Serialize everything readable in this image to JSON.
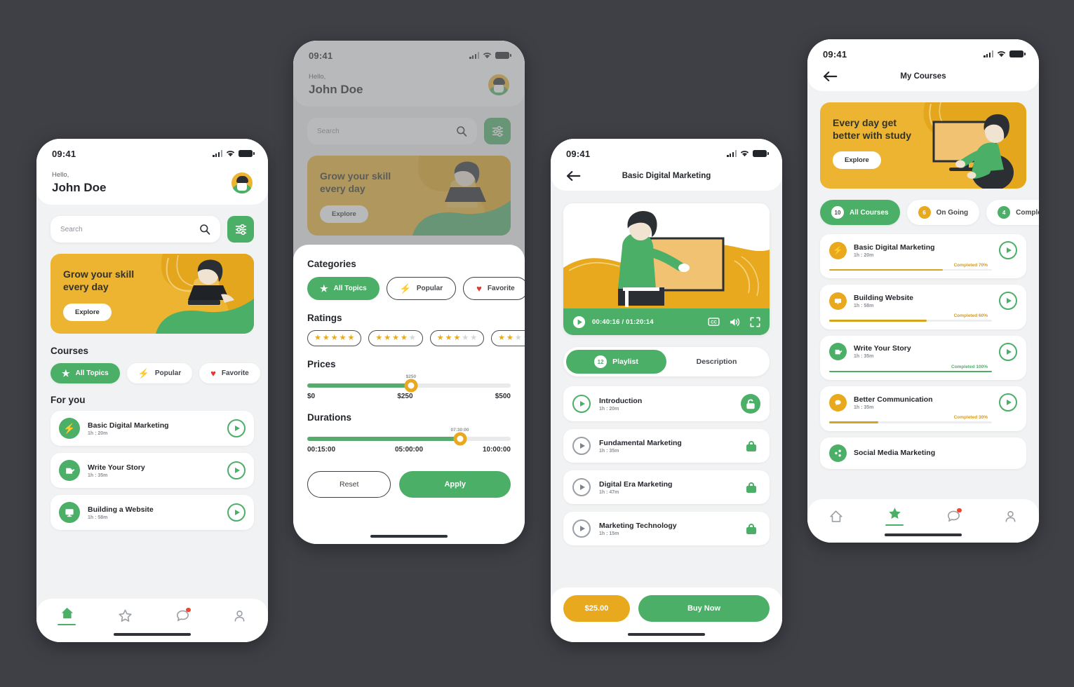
{
  "canvas": {
    "background": "#3e4046"
  },
  "theme": {
    "green": "#4caf68",
    "yellow": "#e8a91e",
    "banner_bg": "#edb431",
    "dark": "#23262b"
  },
  "status_bar": {
    "time": "09:41"
  },
  "screen_home": {
    "greeting_small": "Hello,",
    "user_name": "John Doe",
    "search": {
      "placeholder": "Search",
      "icon": "search-icon"
    },
    "filter_button_icon": "sliders-icon",
    "banner": {
      "title": "Grow your skill\never y day",
      "title_line1": "Grow your skill",
      "title_line2": "every day",
      "cta": "Explore"
    },
    "courses_heading": "Courses",
    "category_chips": [
      {
        "label": "All Topics",
        "icon": "star-icon",
        "active": true
      },
      {
        "label": "Popular",
        "icon": "bolt-icon",
        "active": false
      },
      {
        "label": "Favorite",
        "icon": "heart-icon",
        "active": false
      }
    ],
    "for_you_heading": "For you",
    "courses": [
      {
        "title": "Basic Digital Marketing",
        "duration": "1h : 20m",
        "icon": "bolt-icon"
      },
      {
        "title": "Write Your Story",
        "duration": "1h : 35m",
        "icon": "hand-write-icon"
      },
      {
        "title": "Building a Website",
        "duration": "1h : 58m",
        "icon": "monitor-icon"
      }
    ],
    "nav": [
      {
        "name": "home",
        "icon": "home-icon",
        "active": true,
        "badge": false
      },
      {
        "name": "favorites",
        "icon": "star-icon",
        "active": false,
        "badge": false
      },
      {
        "name": "messages",
        "icon": "chat-icon",
        "active": false,
        "badge": true
      },
      {
        "name": "profile",
        "icon": "user-icon",
        "active": false,
        "badge": false
      }
    ]
  },
  "screen_filter": {
    "greeting_small": "Hello,",
    "user_name": "John Doe",
    "search": {
      "placeholder": "Search"
    },
    "banner": {
      "title_line1": "Grow your skill",
      "title_line2": "every day",
      "cta": "Explore"
    },
    "sheet": {
      "categories_heading": "Categories",
      "category_chips": [
        {
          "label": "All Topics",
          "icon": "star-icon",
          "active": true
        },
        {
          "label": "Popular",
          "icon": "bolt-icon",
          "active": false
        },
        {
          "label": "Favorite",
          "icon": "heart-icon",
          "active": false
        }
      ],
      "ratings_heading": "Ratings",
      "rating_options": [
        5,
        4,
        3,
        2
      ],
      "prices_heading": "Prices",
      "price_knob_label": "$250",
      "price_scale": [
        "$0",
        "$250",
        "$500"
      ],
      "price_fill_percent": 58,
      "durations_heading": "Durations",
      "duration_knob_label": "07:30:00",
      "duration_scale": [
        "00:15:00",
        "05:00:00",
        "10:00:00"
      ],
      "duration_fill_percent": 74,
      "reset_label": "Reset",
      "apply_label": "Apply"
    }
  },
  "screen_player": {
    "title": "Basic Digital Marketing",
    "back_icon": "arrow-left-icon",
    "video": {
      "current_time": "00:40:16",
      "total_time": "01:20:14",
      "time_display": "00:40:16 / 01:20:14",
      "progress_percent": 50,
      "controls": [
        "play-icon",
        "cc-icon",
        "volume-icon",
        "fullscreen-icon"
      ]
    },
    "tabs": [
      {
        "label": "Playlist",
        "count": "12",
        "active": true
      },
      {
        "label": "Description",
        "count": null,
        "active": false
      }
    ],
    "lessons": [
      {
        "title": "Introduction",
        "duration": "1h : 20m",
        "unlocked": true
      },
      {
        "title": "Fundamental Marketing",
        "duration": "1h : 35m",
        "unlocked": false
      },
      {
        "title": "Digital Era Marketing",
        "duration": "1h : 47m",
        "unlocked": false
      },
      {
        "title": "Marketing Technology",
        "duration": "1h : 15m",
        "unlocked": false
      }
    ],
    "price": "$25.00",
    "buy_label": "Buy Now"
  },
  "screen_mycourses": {
    "title": "My Courses",
    "back_icon": "arrow-left-icon",
    "banner": {
      "title_line1": "Every day get",
      "title_line2": "better with study",
      "cta": "Explore"
    },
    "filter_chips": [
      {
        "label": "All Courses",
        "count": "10",
        "active": true,
        "count_color": "#fff"
      },
      {
        "label": "On Going",
        "count": "6",
        "active": false,
        "count_color": "#e8a91e"
      },
      {
        "label": "Completed",
        "count": "4",
        "active": false,
        "count_color": "#4caf68"
      }
    ],
    "courses": [
      {
        "title": "Basic Digital Marketing",
        "duration": "1h : 20m",
        "icon": "bolt-icon",
        "icon_color": "#e8a91e",
        "progress": 70,
        "progress_label": "Completed 70%",
        "bar_color": "#e8a91e"
      },
      {
        "title": "Building Website",
        "duration": "1h : 58m",
        "icon": "monitor-icon",
        "icon_color": "#e8a91e",
        "progress": 60,
        "progress_label": "Completed 60%",
        "bar_color": "#e8a91e"
      },
      {
        "title": "Write Your Story",
        "duration": "1h : 35m",
        "icon": "hand-write-icon",
        "icon_color": "#4caf68",
        "progress": 100,
        "progress_label": "Completed 100%",
        "bar_color": "#4caf68"
      },
      {
        "title": "Better Communication",
        "duration": "1h : 35m",
        "icon": "chat-icon",
        "icon_color": "#e8a91e",
        "progress": 30,
        "progress_label": "Completed 30%",
        "bar_color": "#e8a91e"
      },
      {
        "title": "Social Media Marketing",
        "duration": "",
        "icon": "share-icon",
        "icon_color": "#4caf68",
        "progress": 0,
        "progress_label": "",
        "bar_color": "#4caf68"
      }
    ],
    "nav": [
      {
        "name": "home",
        "icon": "home-icon",
        "active": false,
        "badge": false
      },
      {
        "name": "favorites",
        "icon": "star-icon",
        "active": true,
        "badge": false
      },
      {
        "name": "messages",
        "icon": "chat-icon",
        "active": false,
        "badge": true
      },
      {
        "name": "profile",
        "icon": "user-icon",
        "active": false,
        "badge": false
      }
    ]
  }
}
